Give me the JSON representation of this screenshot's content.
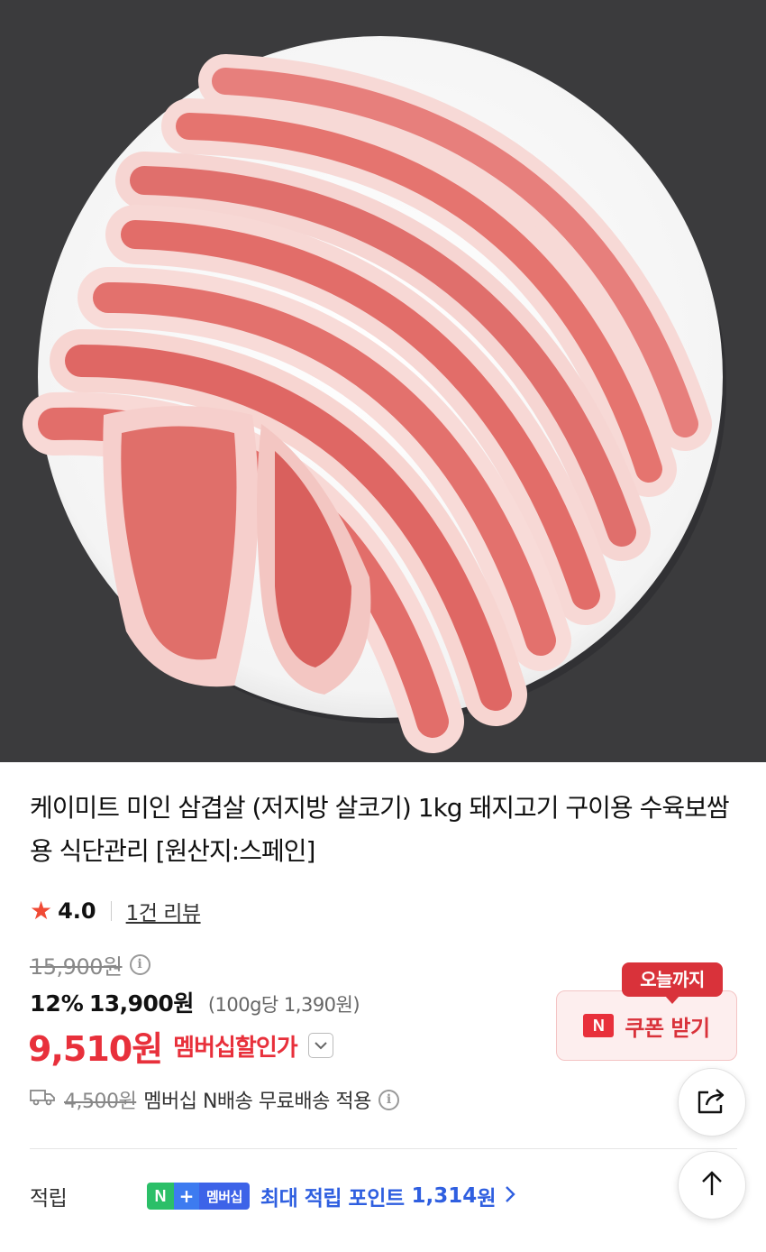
{
  "product": {
    "image_alt": "삼겹살 상품 이미지",
    "title": "케이미트 미인 삼겹살 (저지방 살코기) 1kg 돼지고기 구이용 수육보쌈용 식단관리 [원산지:스페인]"
  },
  "rating": {
    "value": "4.0",
    "review_link": "1건 리뷰"
  },
  "price": {
    "original": "15,900원",
    "discount_rate": "12%",
    "sale_price": "13,900원",
    "unit_price": "(100g당 1,390원)",
    "member_price": "9,510원",
    "member_label": "멤버십할인가"
  },
  "shipping": {
    "original_fee": "4,500원",
    "text": "멤버십 N배송 무료배송 적용"
  },
  "coupon": {
    "badge": "오늘까지",
    "logo": "N",
    "button_label": "쿠폰 받기"
  },
  "points": {
    "label": "적립",
    "badge_n": "N",
    "badge_plus": "+",
    "badge_member": "멤버십",
    "text": "최대 적립 포인트",
    "amount": "1,314",
    "unit": "원"
  },
  "icons": {
    "star": "star-icon",
    "info": "info-icon",
    "truck": "truck-icon",
    "share": "share-icon",
    "top": "arrow-up-icon",
    "dropdown": "chevron-down-icon",
    "chevron": "chevron-right-icon"
  },
  "colors": {
    "accent_red": "#e8303b",
    "points_blue": "#2f5fe0",
    "coupon_bg": "#fdeeee"
  }
}
